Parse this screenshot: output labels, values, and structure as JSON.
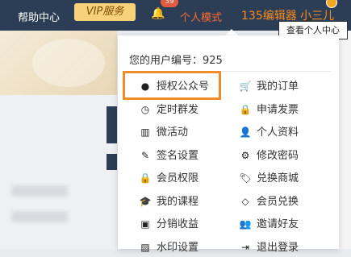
{
  "topbar": {
    "help_label": "帮助中心",
    "vip_label": "VIP服务",
    "notification_count": "39",
    "mode_label": "个人模式",
    "editor_label": "135编辑器 小三儿",
    "bell_icon": "bell-icon"
  },
  "tooltip": {
    "text": "查看个人中心"
  },
  "dropdown": {
    "user_id": "您的用户编号：925",
    "left_items": [
      {
        "label": "授权公众号",
        "icon": "wechat-icon",
        "glyph": "●"
      },
      {
        "label": "定时群发",
        "icon": "clock-icon",
        "glyph": "◷"
      },
      {
        "label": "微活动",
        "icon": "bank-icon",
        "glyph": "▥"
      },
      {
        "label": "签名设置",
        "icon": "pencil-icon",
        "glyph": "✎"
      },
      {
        "label": "会员权限",
        "icon": "lock-icon",
        "glyph": "🔒"
      },
      {
        "label": "我的课程",
        "icon": "graduation-cap-icon",
        "glyph": "🎓"
      },
      {
        "label": "分销收益",
        "icon": "money-icon",
        "glyph": "▣"
      },
      {
        "label": "水印设置",
        "icon": "image-icon",
        "glyph": "▨"
      }
    ],
    "right_items": [
      {
        "label": "我的订单",
        "icon": "cart-icon",
        "glyph": "🛒"
      },
      {
        "label": "申请发票",
        "icon": "lock-icon",
        "glyph": "🔒"
      },
      {
        "label": "个人资料",
        "icon": "user-icon",
        "glyph": "👤"
      },
      {
        "label": "修改密码",
        "icon": "gear-icon",
        "glyph": "⚙"
      },
      {
        "label": "兑换商城",
        "icon": "tag-icon",
        "glyph": "🏷"
      },
      {
        "label": "会员兑换",
        "icon": "diamond-icon",
        "glyph": "◇"
      },
      {
        "label": "邀请好友",
        "icon": "users-icon",
        "glyph": "👥"
      },
      {
        "label": "退出登录",
        "icon": "sign-out-icon",
        "glyph": "⇥"
      }
    ]
  },
  "colors": {
    "topbar_bg": "#2c3e55",
    "mode_text": "#ff6a2e",
    "editor_text": "#ff8c1a",
    "highlight_border": "#f08c2a",
    "vip_bg": "#f8d27a"
  }
}
